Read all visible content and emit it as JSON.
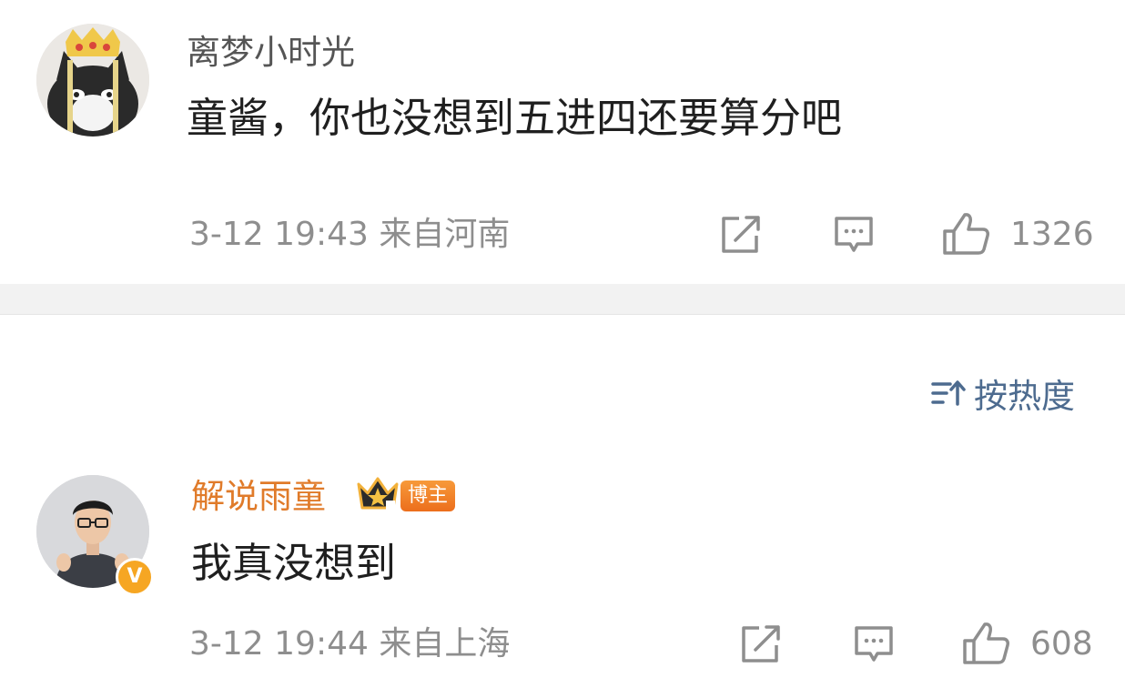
{
  "comments": [
    {
      "username": "离梦小时光",
      "text": "童酱，你也没想到五进四还要算分吧",
      "meta": "3-12 19:43 来自河南",
      "likes": "1326"
    },
    {
      "username": "解说雨童",
      "badge": "博主",
      "text": "我真没想到",
      "meta": "3-12 19:44 来自上海",
      "likes": "608",
      "verified_mark": "V"
    }
  ],
  "sort": {
    "label": "按热度"
  },
  "colors": {
    "username_default": "#555555",
    "username_creator": "#e07b2a",
    "badge": "#ec6e1c",
    "sort": "#4d6b8f",
    "meta": "#8e8e8e",
    "divider": "#f2f2f2"
  },
  "icons": [
    "avatar-cat",
    "share-icon",
    "comment-icon",
    "like-icon",
    "sort-icon",
    "crown-icon",
    "verified-icon"
  ]
}
